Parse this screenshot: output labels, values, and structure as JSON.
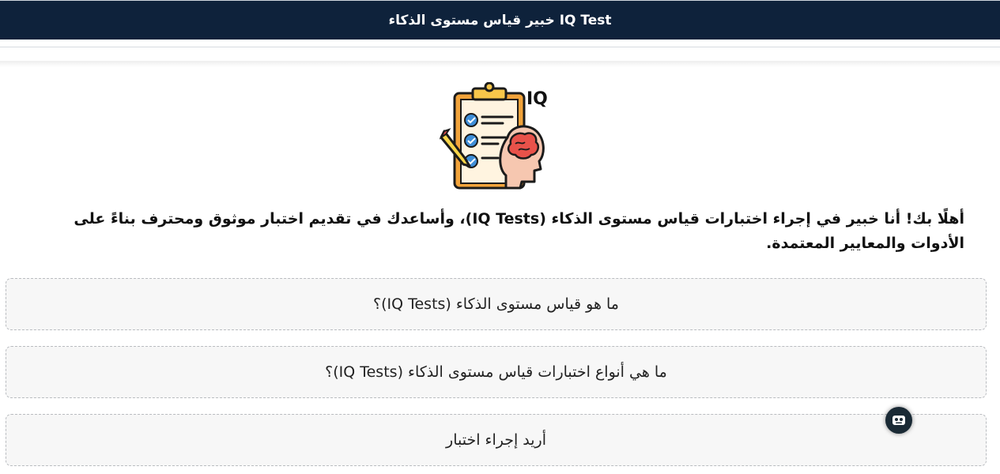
{
  "header": {
    "title": "خبير قياس مستوى الذكاء IQ Test"
  },
  "hero": {
    "icon_name": "iq-test-clipboard-brain-icon",
    "label": "IQ"
  },
  "intro": {
    "text": "أهلًا بك! أنا خبير في إجراء اختبارات قياس مستوى الذكاء (IQ Tests)، وأساعدك في تقديم اختبار موثوق ومحترف بناءً على الأدوات والمعايير المعتمدة."
  },
  "options": [
    {
      "label": "ما هو قياس مستوى الذكاء (IQ Tests)؟"
    },
    {
      "label": "ما هي أنواع اختبارات قياس مستوى الذكاء (IQ Tests)؟"
    },
    {
      "label": "أريد إجراء اختبار"
    }
  ],
  "fab": {
    "icon_name": "chat-bot-icon"
  },
  "colors": {
    "header_bg": "#0e223b",
    "option_bg": "#f7f7f7",
    "option_border": "#b9bcc0"
  }
}
